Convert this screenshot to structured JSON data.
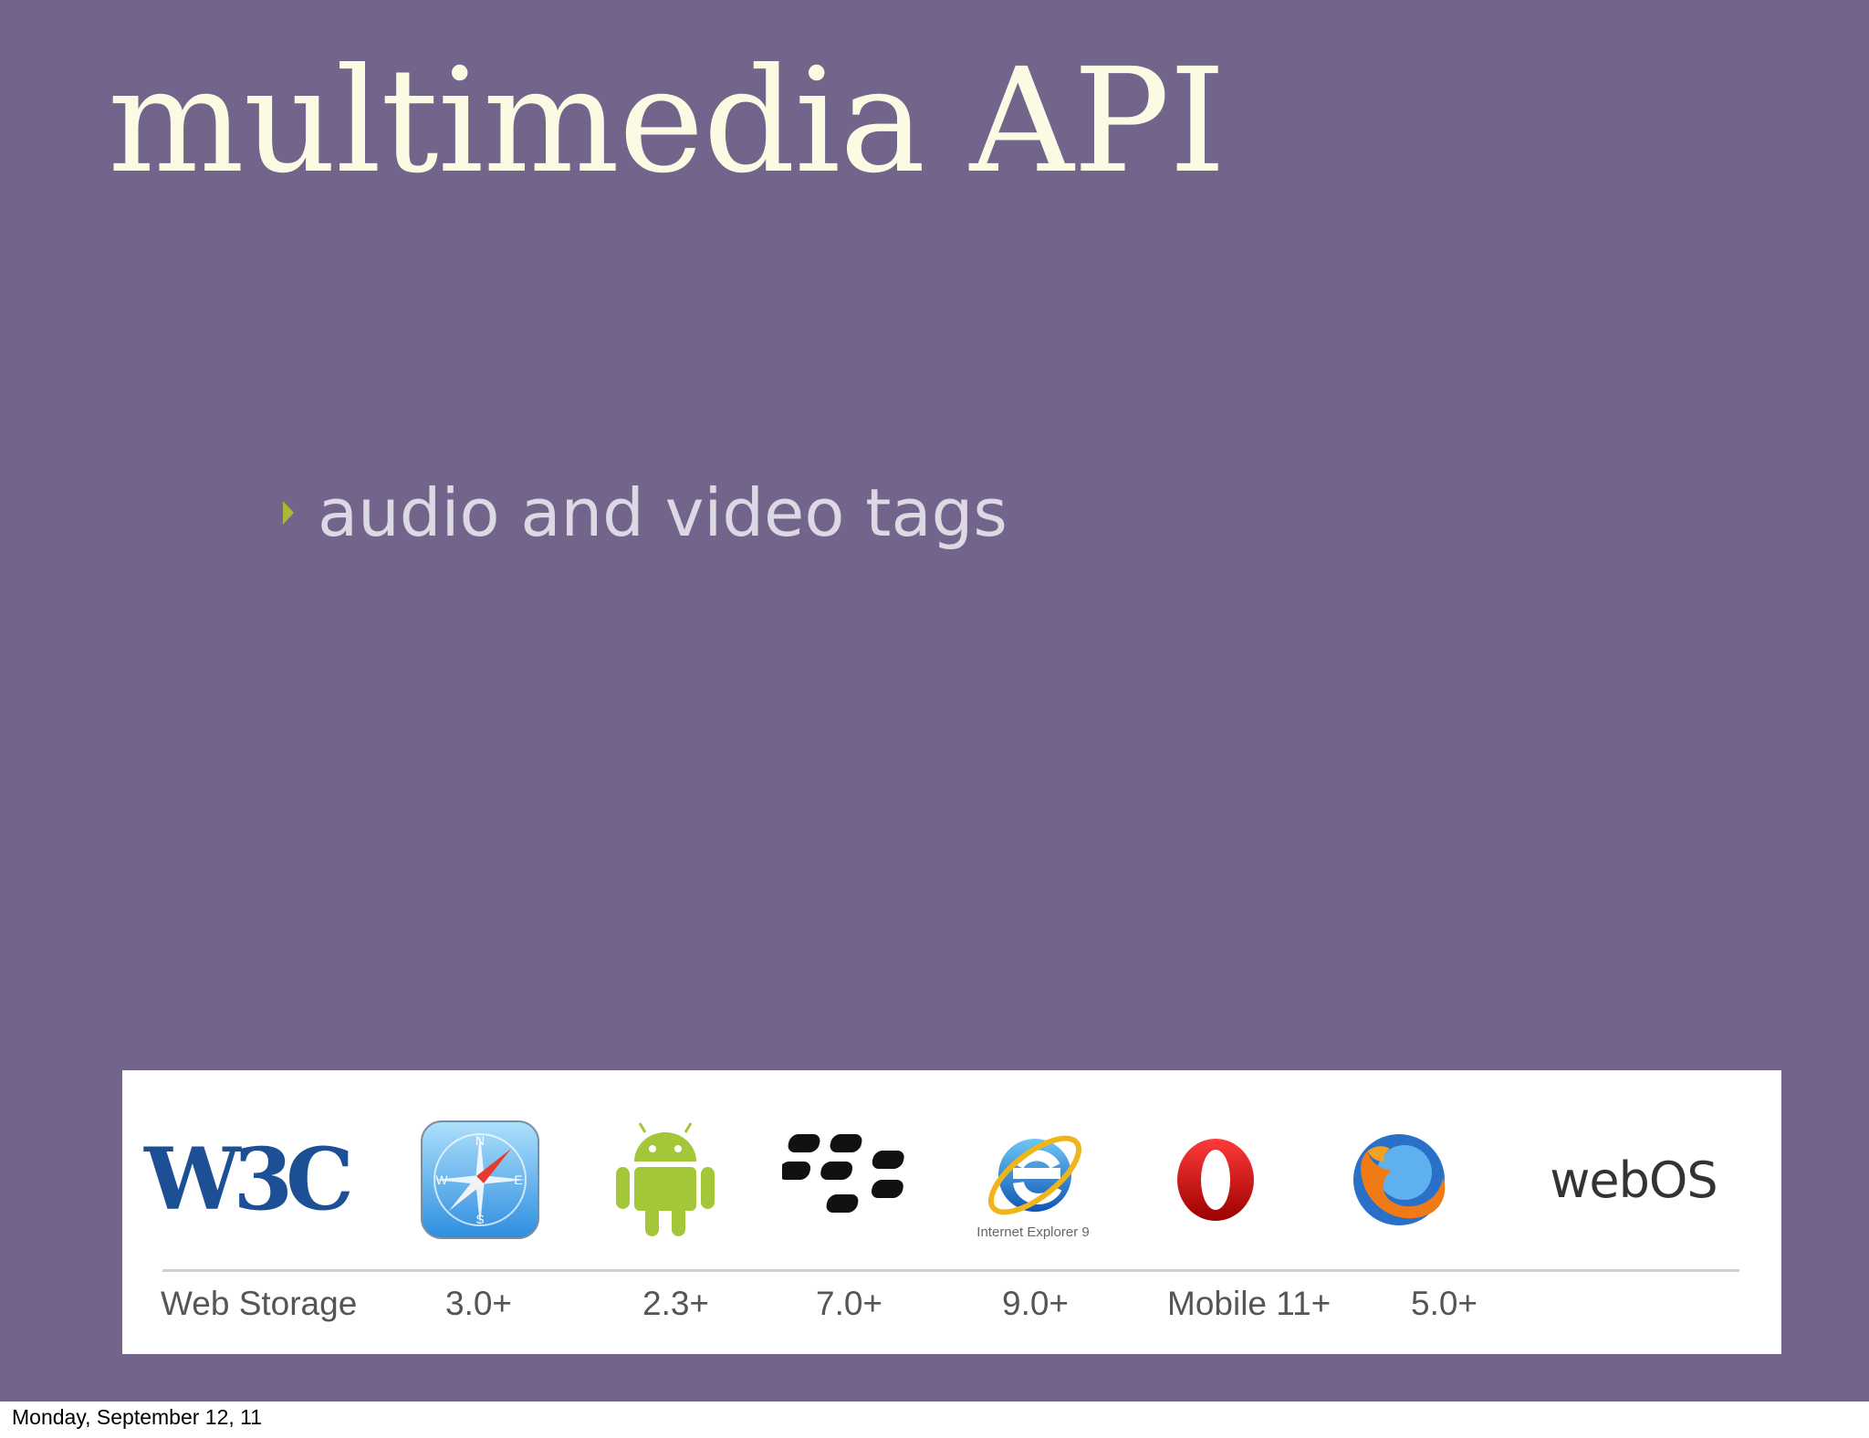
{
  "slide": {
    "title": "multimedia API",
    "bullets": [
      "audio and video tags"
    ],
    "colors": {
      "background": "#73648b",
      "title": "#fbfbe3",
      "bullet_marker": "#a8b935"
    }
  },
  "support_table": {
    "logos": [
      {
        "icon": "w3c-logo",
        "text": "W3C"
      },
      {
        "icon": "safari-compass-icon"
      },
      {
        "icon": "android-robot-icon"
      },
      {
        "icon": "blackberry-logo-icon"
      },
      {
        "icon": "internet-explorer-icon",
        "caption": "Internet Explorer 9"
      },
      {
        "icon": "opera-logo-icon"
      },
      {
        "icon": "firefox-logo-icon"
      },
      {
        "icon": "webos-logo",
        "text": "webOS"
      }
    ],
    "versions": [
      "Web Storage",
      "3.0+",
      "2.3+",
      "7.0+",
      "9.0+",
      "Mobile 11+",
      "5.0+"
    ]
  },
  "footer": {
    "date": "Monday, September 12, 11"
  }
}
